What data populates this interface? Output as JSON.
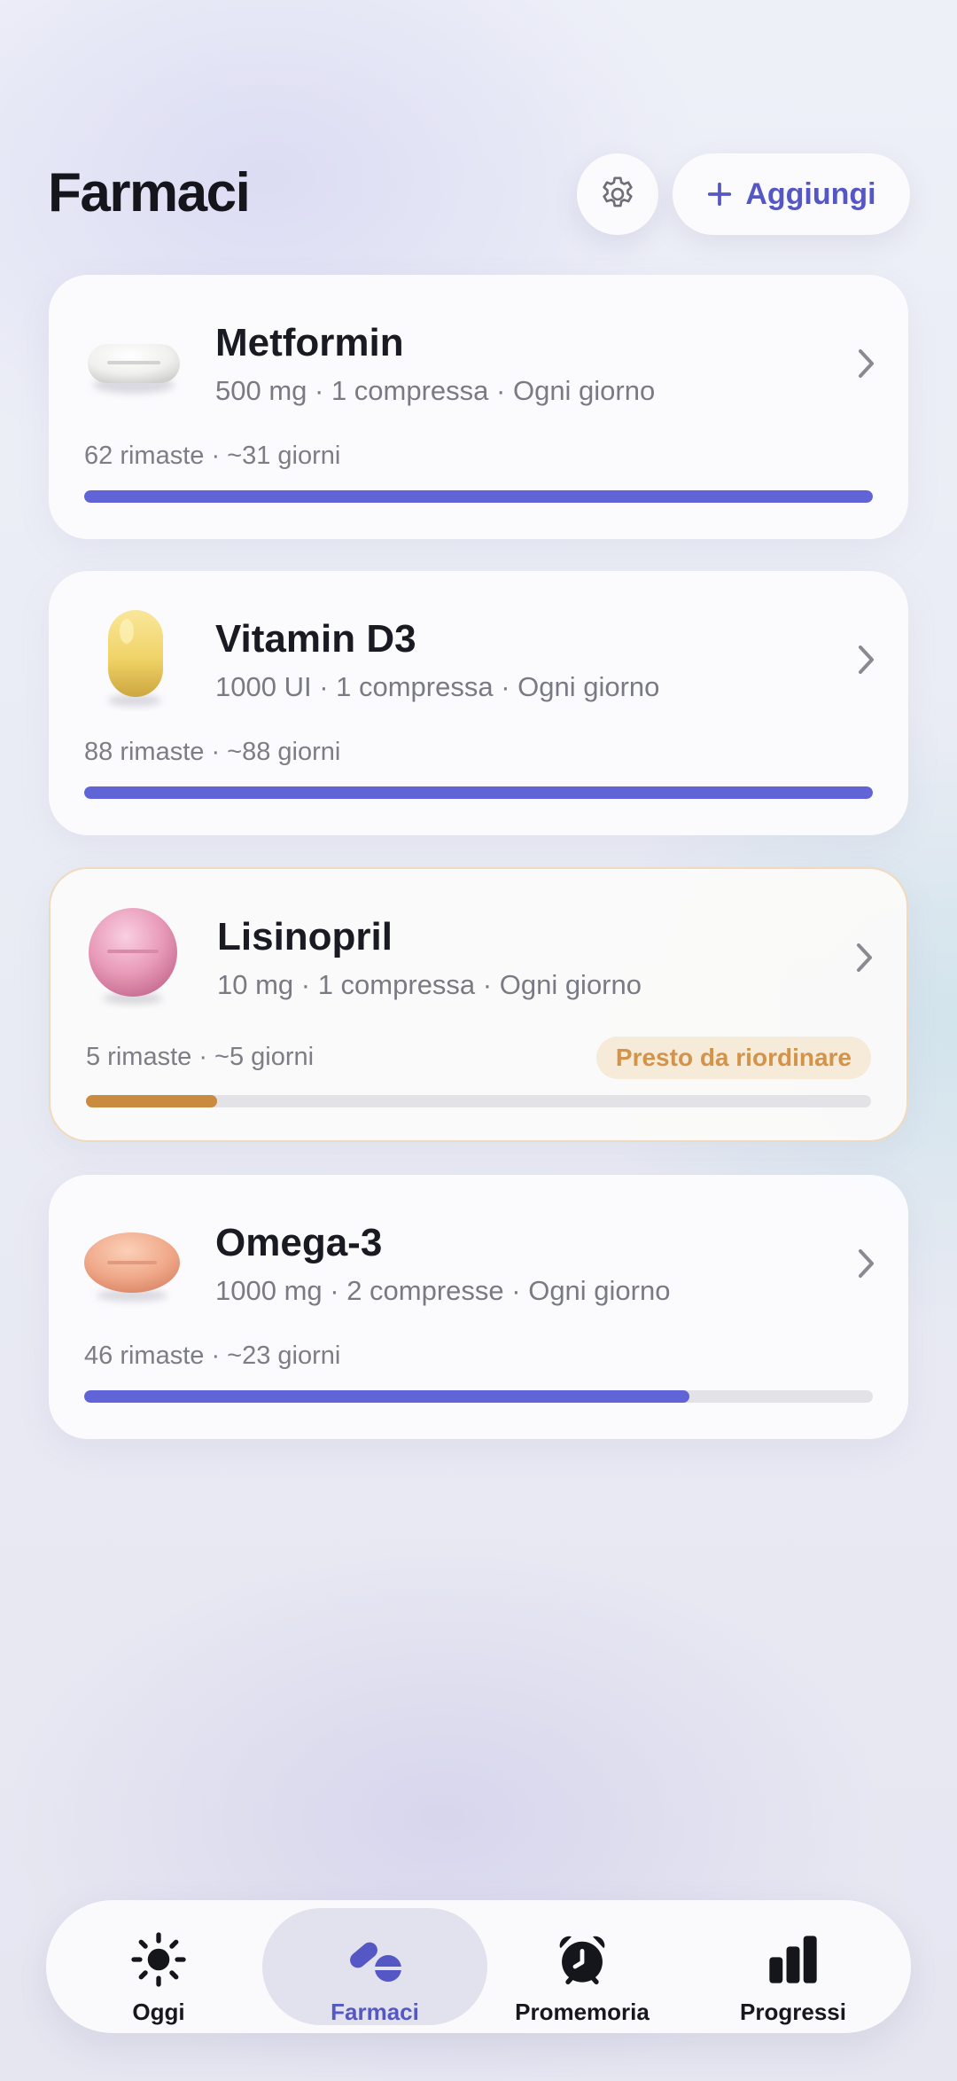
{
  "header": {
    "title": "Farmaci",
    "settings_icon": "gear-icon",
    "add_label": "Aggiungi",
    "add_icon": "plus-icon"
  },
  "colors": {
    "accent": "#5457c4",
    "progress": "#6064d6",
    "warning": "#c98b40",
    "warning_text": "#d39348"
  },
  "medications": [
    {
      "name": "Metformin",
      "dose": "500 mg · 1 compressa · Ogni giorno",
      "stock": "62 rimaste · ~31 giorni",
      "level": 1.0,
      "pill": "white-oval-tablet"
    },
    {
      "name": "Vitamin D3",
      "dose": "1000 UI · 1 compressa · Ogni giorno",
      "stock": "88 rimaste · ~88 giorni",
      "level": 1.0,
      "pill": "yellow-capsule"
    },
    {
      "name": "Lisinopril",
      "dose": "10 mg · 1 compressa · Ogni giorno",
      "stock": "5 rimaste · ~5 giorni",
      "level": 0.167,
      "badge": "Presto da riordinare",
      "pill": "pink-round-tablet"
    },
    {
      "name": "Omega-3",
      "dose": "1000 mg · 2 compresse · Ogni giorno",
      "stock": "46 rimaste · ~23 giorni",
      "level": 0.767,
      "pill": "orange-oval-tablet"
    }
  ],
  "tabs": [
    {
      "label": "Oggi",
      "icon": "sun-icon",
      "active": false
    },
    {
      "label": "Farmaci",
      "icon": "pills-icon",
      "active": true
    },
    {
      "label": "Promemoria",
      "icon": "alarm-clock-icon",
      "active": false
    },
    {
      "label": "Progressi",
      "icon": "bar-chart-icon",
      "active": false
    }
  ]
}
